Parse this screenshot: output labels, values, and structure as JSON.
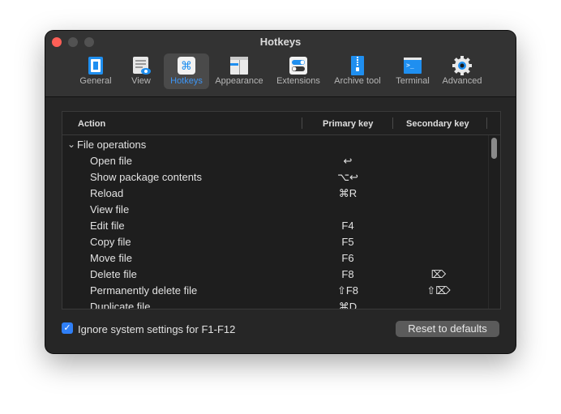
{
  "window": {
    "title": "Hotkeys"
  },
  "toolbar": [
    {
      "label": "General",
      "icon": "general-icon"
    },
    {
      "label": "View",
      "icon": "view-icon"
    },
    {
      "label": "Hotkeys",
      "icon": "command-key-icon",
      "active": true
    },
    {
      "label": "Appearance",
      "icon": "appearance-icon"
    },
    {
      "label": "Extensions",
      "icon": "toggle-switches-icon"
    },
    {
      "label": "Archive tool",
      "icon": "zipper-archive-icon"
    },
    {
      "label": "Terminal",
      "icon": "terminal-icon"
    },
    {
      "label": "Advanced",
      "icon": "gear-icon"
    }
  ],
  "table": {
    "headers": {
      "action": "Action",
      "primary": "Primary key",
      "secondary": "Secondary key"
    },
    "group": {
      "label": "File operations",
      "expanded": true
    },
    "rows": [
      {
        "action": "Open file",
        "primary": "↩",
        "secondary": ""
      },
      {
        "action": "Show package contents",
        "primary": "⌥↩",
        "secondary": ""
      },
      {
        "action": "Reload",
        "primary": "⌘R",
        "secondary": ""
      },
      {
        "action": "View file",
        "primary": "",
        "secondary": ""
      },
      {
        "action": "Edit file",
        "primary": "F4",
        "secondary": ""
      },
      {
        "action": "Copy file",
        "primary": "F5",
        "secondary": ""
      },
      {
        "action": "Move file",
        "primary": "F6",
        "secondary": ""
      },
      {
        "action": "Delete file",
        "primary": "F8",
        "secondary": "⌦"
      },
      {
        "action": "Permanently delete file",
        "primary": "⇧F8",
        "secondary": "⇧⌦"
      },
      {
        "action": "Duplicate file",
        "primary": "⌘D",
        "secondary": ""
      }
    ]
  },
  "footer": {
    "checkbox_label": "Ignore system settings for F1-F12",
    "checkbox_checked": true,
    "reset_label": "Reset to defaults"
  },
  "colors": {
    "accent": "#3d95f5",
    "close": "#fe5f57",
    "checkbox": "#2f7ff7"
  }
}
